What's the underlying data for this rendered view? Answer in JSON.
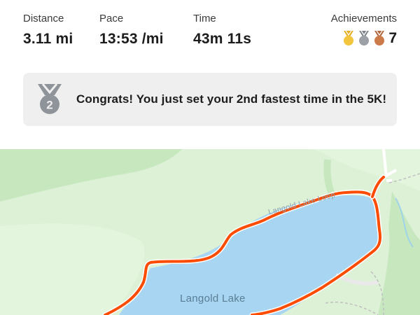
{
  "stats": {
    "distance": {
      "label": "Distance",
      "value": "3.11 mi"
    },
    "pace": {
      "label": "Pace",
      "value": "13:53 /mi"
    },
    "time": {
      "label": "Time",
      "value": "43m 11s"
    },
    "achievements": {
      "label": "Achievements",
      "count": "7",
      "medals": [
        "gold-medal-icon",
        "silver-medal-icon",
        "bronze-medal-icon"
      ]
    }
  },
  "banner": {
    "icon": "silver-medal-icon",
    "medal_number": "2",
    "message": "Congrats! You just set your 2nd fastest time in the 5K!"
  },
  "map": {
    "lake_name": "Langold Lake",
    "road_name": "Langold Lake Loop",
    "colors": {
      "route": "#fc4c02",
      "water": "#a8d5f2",
      "land": "#dcf1d6",
      "woods": "#c7e8bf"
    }
  },
  "colors": {
    "gold": "#f2c53d",
    "silver": "#9aa0a6",
    "bronze": "#cc7a4a",
    "banner_bg": "#efefef"
  }
}
